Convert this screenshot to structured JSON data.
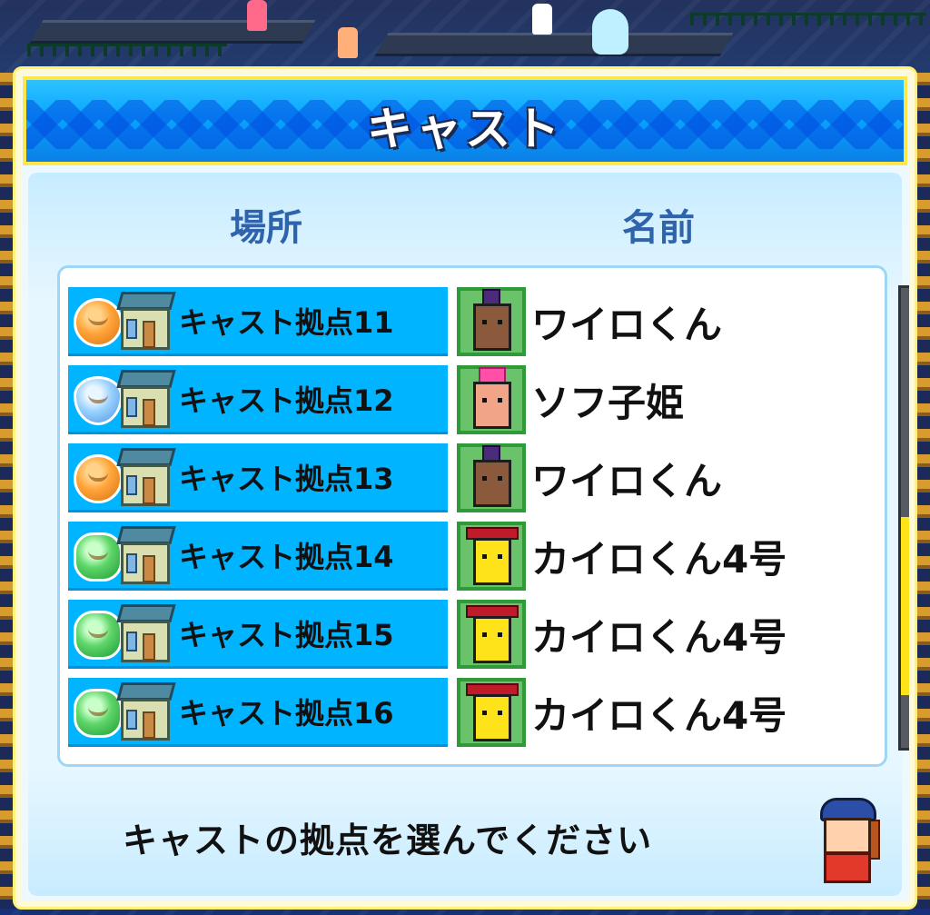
{
  "dialog": {
    "title": "キャスト"
  },
  "columns": {
    "place": "場所",
    "name": "名前"
  },
  "rows": [
    {
      "place": "キャスト拠点11",
      "place_icon": "orange-coin-icon",
      "name": "ワイロくん",
      "avatar": "brown-character-avatar"
    },
    {
      "place": "キャスト拠点12",
      "place_icon": "blue-drop-icon",
      "name": "ソフ子姫",
      "avatar": "pink-character-avatar"
    },
    {
      "place": "キャスト拠点13",
      "place_icon": "orange-coin-icon",
      "name": "ワイロくん",
      "avatar": "brown-character-avatar"
    },
    {
      "place": "キャスト拠点14",
      "place_icon": "green-star-icon",
      "name": "カイロくん4号",
      "avatar": "yellow-robot-avatar"
    },
    {
      "place": "キャスト拠点15",
      "place_icon": "green-star-icon",
      "name": "カイロくん4号",
      "avatar": "yellow-robot-avatar"
    },
    {
      "place": "キャスト拠点16",
      "place_icon": "green-star-icon",
      "name": "カイロくん4号",
      "avatar": "yellow-robot-avatar"
    }
  ],
  "scroll": {
    "position_fraction": 0.5,
    "visible_fraction": 0.39
  },
  "footer": {
    "instruction": "キャストの拠点を選んでください",
    "guide_icon": "guide-girl-icon"
  },
  "colors": {
    "title_bar": "#0aa4ff",
    "title_border": "#ffe74a",
    "row_place_bg": "#00b4ff",
    "avatar_bg": "#6ac26a",
    "header_text": "#2f63ab",
    "scroll_thumb": "#ffe31a"
  }
}
